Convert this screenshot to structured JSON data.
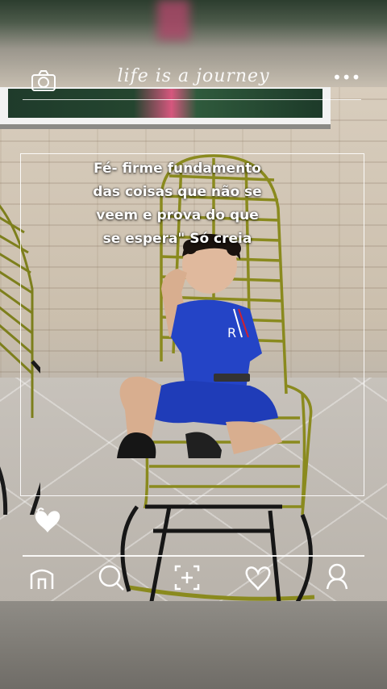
{
  "header": {
    "title": "life is a journey",
    "camera_icon": "camera-icon",
    "more_icon": "more-dots-icon",
    "more_label": "•••"
  },
  "post": {
    "caption_lines": [
      "Fé- firme fundamento",
      "das coisas que não se",
      "veem e prova do que",
      "se espera\" Só creia"
    ],
    "like_icon": "heart-icon"
  },
  "bottom_nav": {
    "items": [
      {
        "icon": "home-icon"
      },
      {
        "icon": "search-icon"
      },
      {
        "icon": "add-post-icon"
      },
      {
        "icon": "heart-icon"
      },
      {
        "icon": "profile-icon"
      }
    ]
  },
  "colors": {
    "overlay": "#ffffff",
    "chair": "#8a8a1e",
    "shirt": "#1e3fbf"
  }
}
